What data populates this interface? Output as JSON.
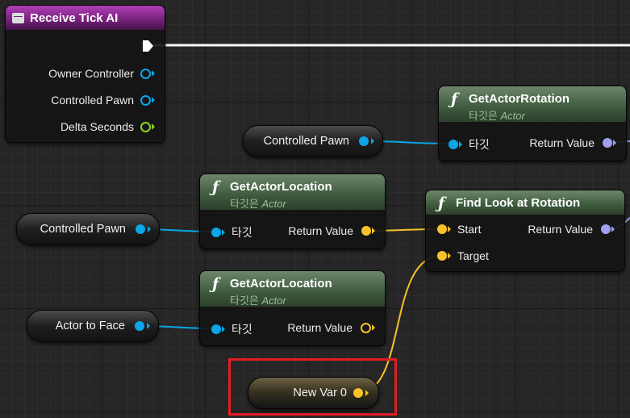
{
  "event_node": {
    "title": "Receive Tick AI",
    "pins": [
      "Owner Controller",
      "Controlled Pawn",
      "Delta Seconds"
    ]
  },
  "variables": {
    "controlled_pawn_1": "Controlled Pawn",
    "controlled_pawn_2": "Controlled Pawn",
    "actor_to_face": "Actor to Face",
    "new_var": "New Var 0"
  },
  "get_actor_rotation": {
    "title": "GetActorRotation",
    "subtitle_prefix": "타깃은",
    "subtitle_class": "Actor",
    "target_label": "타깃",
    "return_label": "Return Value"
  },
  "get_actor_location_1": {
    "title": "GetActorLocation",
    "subtitle_prefix": "타깃은",
    "subtitle_class": "Actor",
    "target_label": "타깃",
    "return_label": "Return Value"
  },
  "get_actor_location_2": {
    "title": "GetActorLocation",
    "subtitle_prefix": "타깃은",
    "subtitle_class": "Actor",
    "target_label": "타깃",
    "return_label": "Return Value"
  },
  "find_look_at_rotation": {
    "title": "Find Look at Rotation",
    "start_label": "Start",
    "target_label": "Target",
    "return_label": "Return Value"
  },
  "func_icon": "ƒ",
  "colors": {
    "object_pin": "#0ba5e8",
    "float_pin": "#8ed421",
    "vector_pin": "#f7c22a",
    "rotator_pin": "#9da0f3",
    "exec_wire": "#ffffff",
    "highlight": "#e21d25"
  }
}
